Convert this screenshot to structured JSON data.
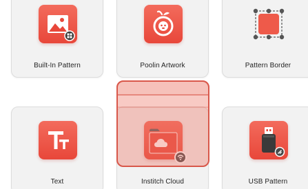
{
  "tiles": [
    {
      "id": "builtin",
      "label": "Built-In Pattern",
      "icon": "image-icon"
    },
    {
      "id": "poolin",
      "label": "Poolin Artwork",
      "icon": "fruit-icon"
    },
    {
      "id": "border",
      "label": "Pattern Border",
      "icon": "border-select-icon"
    },
    {
      "id": "text",
      "label": "Text",
      "icon": "text-icon"
    },
    {
      "id": "cloud",
      "label": "Institch Cloud",
      "icon": "cloud-folder-icon"
    },
    {
      "id": "usb",
      "label": "USB Pattern",
      "icon": "usb-drive-icon"
    }
  ],
  "colors": {
    "accent": "#e8473a",
    "accent_light": "#f36b5c",
    "tile_bg": "#f2f2f2",
    "drag_highlight": "#d8574a"
  }
}
